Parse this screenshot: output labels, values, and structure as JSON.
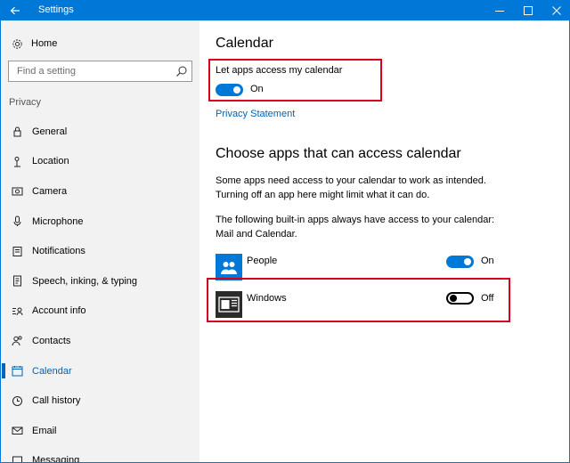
{
  "window": {
    "title": "Settings"
  },
  "sidebar": {
    "home_label": "Home",
    "search_placeholder": "Find a setting",
    "section_label": "Privacy",
    "items": [
      {
        "label": "General",
        "icon": "lock-icon"
      },
      {
        "label": "Location",
        "icon": "location-icon"
      },
      {
        "label": "Camera",
        "icon": "camera-icon"
      },
      {
        "label": "Microphone",
        "icon": "microphone-icon"
      },
      {
        "label": "Notifications",
        "icon": "notifications-icon"
      },
      {
        "label": "Speech, inking, & typing",
        "icon": "speech-inking-icon"
      },
      {
        "label": "Account info",
        "icon": "account-info-icon"
      },
      {
        "label": "Contacts",
        "icon": "contacts-icon"
      },
      {
        "label": "Calendar",
        "icon": "calendar-icon",
        "active": true
      },
      {
        "label": "Call history",
        "icon": "call-history-icon"
      },
      {
        "label": "Email",
        "icon": "email-icon"
      },
      {
        "label": "Messaging",
        "icon": "messaging-icon"
      }
    ]
  },
  "main": {
    "title": "Calendar",
    "access_label": "Let apps access my calendar",
    "access_state": "On",
    "privacy_link": "Privacy Statement",
    "choose_title": "Choose apps that can access calendar",
    "desc1": "Some apps need access to your calendar to work as intended. Turning off an app here might limit what it can do.",
    "desc2": "The following built-in apps always have access to your calendar: Mail and Calendar.",
    "apps": [
      {
        "name": "People",
        "state": "On",
        "icon": "people-app-icon"
      },
      {
        "name": "Windows",
        "state": "Off",
        "icon": "windows-app-icon"
      }
    ]
  },
  "colors": {
    "accent": "#0078d7",
    "highlight": "#d9001b",
    "link": "#0063b1",
    "sidebar_bg": "#f2f2f2"
  }
}
